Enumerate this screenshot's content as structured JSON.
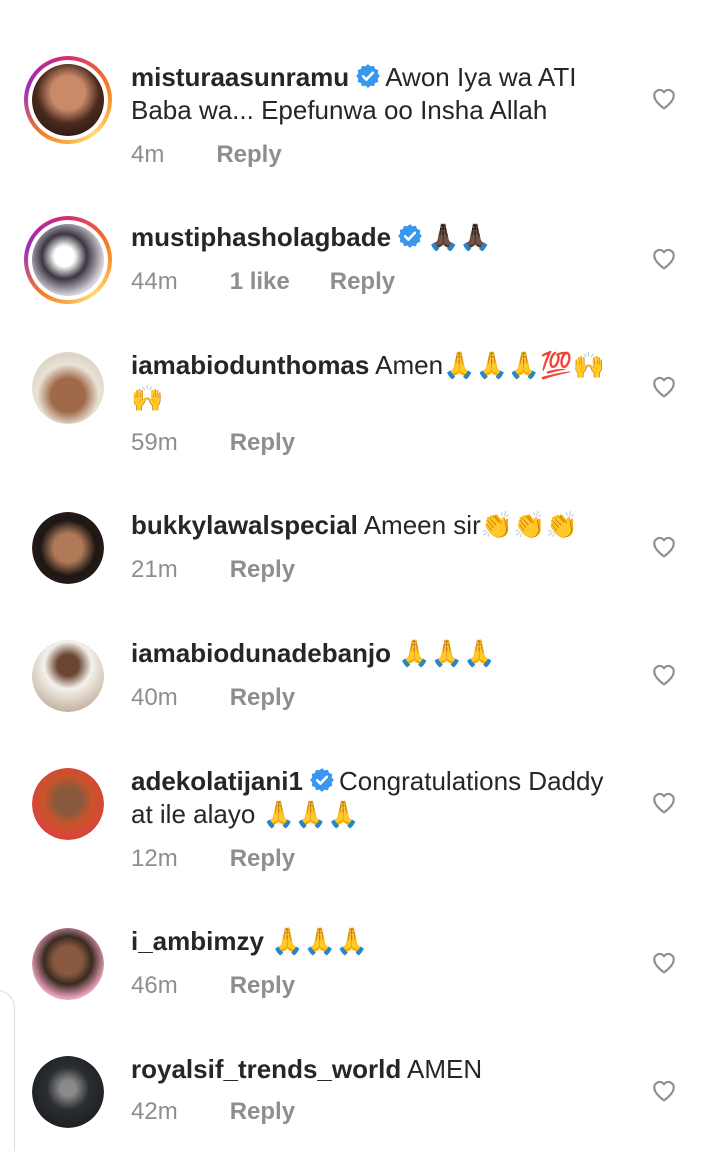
{
  "colors": {
    "verified": "#3897f0",
    "meta_text": "#8e8e8e",
    "primary_text": "#262626",
    "story_ring": "#fa7e1e"
  },
  "icons": {
    "verified": "verified-badge-icon",
    "heart": "heart-outline-icon"
  },
  "comments": [
    {
      "username": "misturaasunramu",
      "verified": true,
      "text": "Awon Iya wa ATI Baba wa... Epefunwa oo Insha Allah",
      "time": "4m",
      "likes": "",
      "reply": "Reply"
    },
    {
      "username": "mustiphasholagbade",
      "verified": true,
      "text": "🙏🏿🙏🏿",
      "time": "44m",
      "likes": "1 like",
      "reply": "Reply"
    },
    {
      "username": "iamabiodunthomas",
      "verified": false,
      "text": "Amen🙏🙏🙏💯🙌🙌",
      "time": "59m",
      "likes": "",
      "reply": "Reply"
    },
    {
      "username": "bukkylawalspecial",
      "verified": false,
      "text": "Ameen sir👏👏👏",
      "time": "21m",
      "likes": "",
      "reply": "Reply"
    },
    {
      "username": "iamabiodunadebanjo",
      "verified": false,
      "text": "🙏🙏🙏",
      "time": "40m",
      "likes": "",
      "reply": "Reply"
    },
    {
      "username": "adekolatijani1",
      "verified": true,
      "text": "Congratulations Daddy at ile alayo 🙏🙏🙏",
      "time": "12m",
      "likes": "",
      "reply": "Reply"
    },
    {
      "username": "i_ambimzy",
      "verified": false,
      "text": "🙏🙏🙏",
      "time": "46m",
      "likes": "",
      "reply": "Reply"
    },
    {
      "username": "royalsif_trends_world",
      "verified": false,
      "text": "AMEN",
      "time": "42m",
      "likes": "",
      "reply": "Reply"
    }
  ]
}
